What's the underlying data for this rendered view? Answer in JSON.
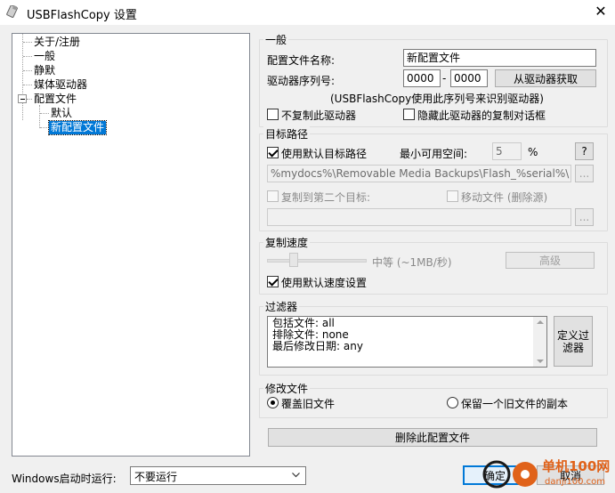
{
  "window": {
    "title": "USBFlashCopy 设置",
    "close_glyph": "✕"
  },
  "tree": {
    "items": [
      {
        "label": "关于/注册"
      },
      {
        "label": "一般"
      },
      {
        "label": "静默"
      },
      {
        "label": "媒体驱动器"
      },
      {
        "label": "配置文件"
      },
      {
        "label": "默认"
      },
      {
        "label": "新配置文件"
      }
    ]
  },
  "general": {
    "group_label": "一般",
    "profile_name_label": "配置文件名称:",
    "profile_name_value": "新配置文件",
    "serial_label": "驱动器序列号:",
    "serial_part1": "0000",
    "serial_dash": "-",
    "serial_part2": "0000",
    "get_from_drive_button": "从驱动器获取",
    "serial_note": "(USBFlashCopy使用此序列号来识别驱动器)",
    "no_copy_label": "不复制此驱动器",
    "hide_dialog_label": "隐藏此驱动器的复制对话框"
  },
  "target": {
    "group_label": "目标路径",
    "use_default_label": "使用默认目标路径",
    "min_space_label": "最小可用空间:",
    "min_space_value": "5",
    "percent": "%",
    "help_button": "?",
    "path_value": "%mydocs%\\Removable Media Backups\\Flash_%serial%\\",
    "browse_button": "...",
    "second_target_label": "复制到第二个目标:",
    "move_files_label": "移动文件 (删除源)",
    "browse2_button": "..."
  },
  "speed": {
    "group_label": "复制速度",
    "speed_value_text": "中等 (~1MB/秒)",
    "advanced_button": "高级",
    "use_default_label": "使用默认速度设置",
    "slider_level_fraction": 0.25
  },
  "filter": {
    "group_label": "过滤器",
    "lines": [
      "包括文件: all",
      "排除文件: none",
      "最后修改日期: any"
    ],
    "define_button_line1": "定义过",
    "define_button_line2": "滤器"
  },
  "modified": {
    "group_label": "修改文件",
    "overwrite_label": "覆盖旧文件",
    "keep_copy_label": "保留一个旧文件的副本"
  },
  "delete_profile_button": "删除此配置文件",
  "footer": {
    "startup_label": "Windows启动时运行:",
    "startup_value": "不要运行",
    "ok_button": "确定",
    "cancel_button": "取消"
  },
  "watermark": {
    "text": "单机100网",
    "sub": "danji100.com"
  },
  "colors": {
    "selection": "#0078d7",
    "accent_border": "#0078d7",
    "watermark": "#e0621a"
  }
}
